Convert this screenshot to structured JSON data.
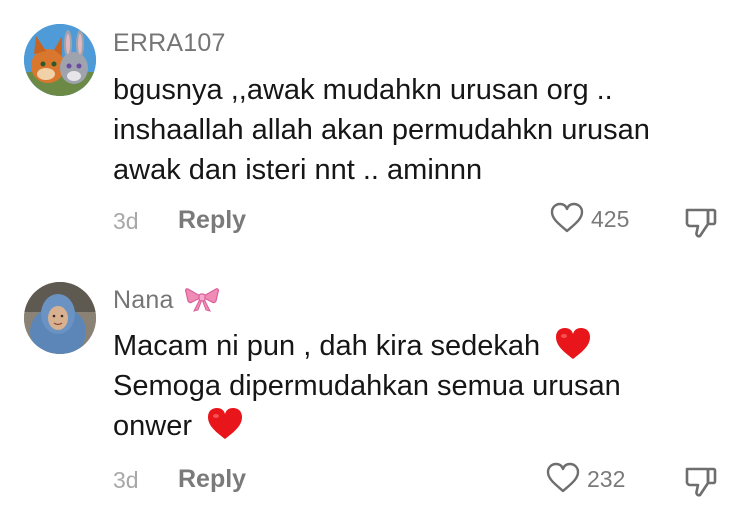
{
  "comments": [
    {
      "username": "ERRA107",
      "avatar": "cartoon-fox-rabbit-avatar",
      "text": "bgusnya ,,awak mudahkn urusan org ..\ninshaallah allah akan permudahkn urusan\nawak dan isteri nnt .. aminnn",
      "date": "3d",
      "reply_label": "Reply",
      "likes": "425"
    },
    {
      "username": "Nana",
      "username_emoji": "pink-bow-emoji",
      "avatar": "woman-hijab-avatar",
      "text_line1": "Macam ni pun , dah kira sedekah",
      "text_line2": "Semoga dipermudahkan semua urusan",
      "text_line3": "onwer",
      "text_emoji": "red-heart-emoji",
      "date": "3d",
      "reply_label": "Reply",
      "likes": "232"
    }
  ],
  "colors": {
    "username": "#757575",
    "text": "#161616",
    "date": "#a8a8a8",
    "action": "#7a7a7a",
    "heart_emoji": "#e8161b",
    "bow_emoji": "#f08bb6"
  }
}
